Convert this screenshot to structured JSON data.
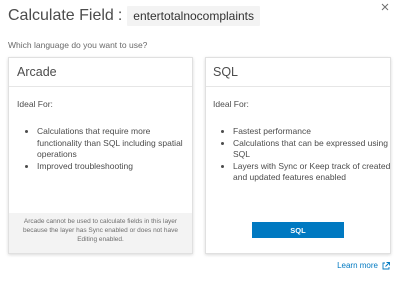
{
  "header": {
    "title": "Calculate Field",
    "colon": ":",
    "field_name": "entertotalnocomplaints",
    "close_icon": "close-icon"
  },
  "question": "Which language do you want to use?",
  "arcade": {
    "title": "Arcade",
    "ideal_label": "Ideal For:",
    "bullets": [
      "Calculations that require more functionality than SQL including spatial operations",
      "Improved troubleshooting"
    ],
    "warning": "Arcade cannot be used to calculate fields in this layer because the layer has Sync enabled or does not have Editing enabled."
  },
  "sql": {
    "title": "SQL",
    "ideal_label": "Ideal For:",
    "bullets": [
      "Fastest performance",
      "Calculations that can be expressed using SQL",
      "Layers with Sync or Keep track of created and updated features enabled"
    ],
    "button_label": "SQL"
  },
  "footer": {
    "learn_more": "Learn more",
    "icon": "external-link-icon"
  },
  "colors": {
    "accent": "#0079c1",
    "text": "#4c4c4c",
    "muted_bg": "#f3f3f3"
  }
}
